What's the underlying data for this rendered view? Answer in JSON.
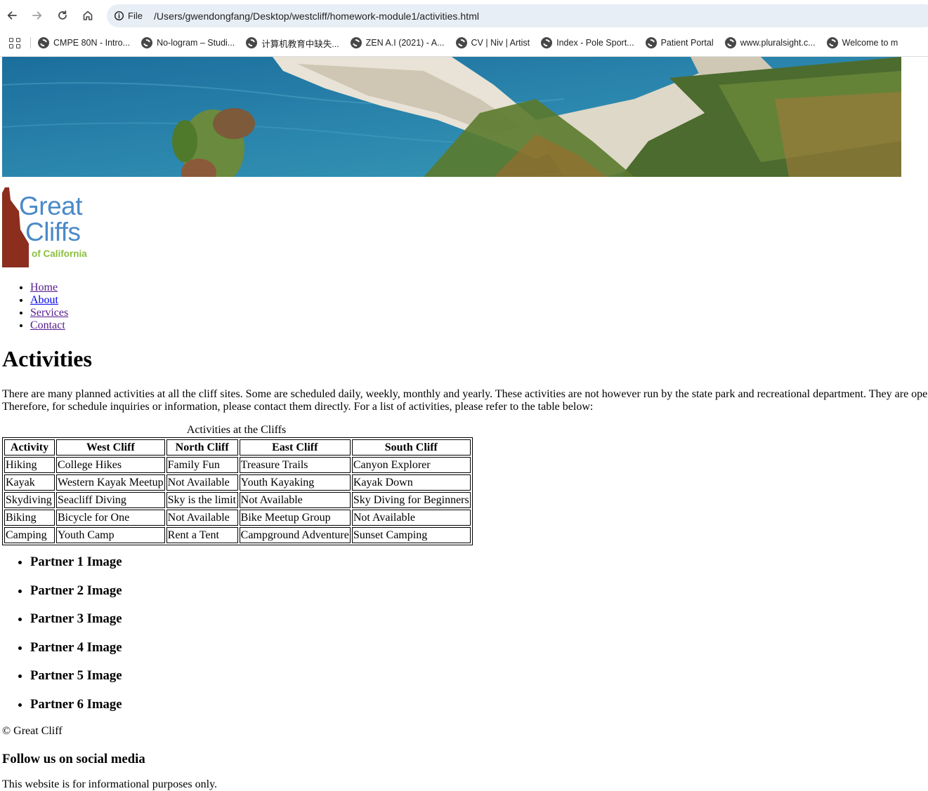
{
  "browser": {
    "address_chip": "File",
    "url": "/Users/gwendongfang/Desktop/westcliff/homework-module1/activities.html",
    "bookmarks": [
      "CMPE 80N - Intro...",
      "No-logram – Studi...",
      "计算机教育中缺失...",
      "ZEN A.I (2021) - A...",
      "CV | Niv | Artist",
      "Index - Pole Sport...",
      "Patient Portal",
      "www.pluralsight.c...",
      "Welcome to m"
    ]
  },
  "logo": {
    "line1": "Great",
    "line2": "Cliffs",
    "line3": "of California",
    "colors": {
      "text": "#4a8ac7",
      "accent": "#8cbf3f",
      "mark": "#8b2e1e"
    }
  },
  "nav": {
    "items": [
      "Home",
      "About",
      "Services",
      "Contact"
    ]
  },
  "page": {
    "title": "Activities",
    "intro_line1": "There are many planned activities at all the cliff sites. Some are scheduled daily, weekly, monthly and yearly. These activities are not however run by the state park and recreational department. They are ope",
    "intro_line2": "Therefore, for schedule inquiries or information, please contact them directly. For a list of activities, please refer to the table below:"
  },
  "table": {
    "caption": "Activities at the Cliffs",
    "headers": [
      "Activity",
      "West Cliff",
      "North Cliff",
      "East Cliff",
      "South Cliff"
    ],
    "rows": [
      [
        "Hiking",
        "College Hikes",
        "Family Fun",
        "Treasure Trails",
        "Canyon Explorer"
      ],
      [
        "Kayak",
        "Western Kayak Meetup",
        "Not Available",
        "Youth Kayaking",
        "Kayak Down"
      ],
      [
        "Skydiving",
        "Seacliff Diving",
        "Sky is the limit",
        "Not Available",
        "Sky Diving for Beginners"
      ],
      [
        "Biking",
        "Bicycle for One",
        "Not Available",
        "Bike Meetup Group",
        "Not Available"
      ],
      [
        "Camping",
        "Youth Camp",
        "Rent a Tent",
        "Campground Adventure",
        "Sunset Camping"
      ]
    ]
  },
  "partners": [
    "Partner 1 Image",
    "Partner 2 Image",
    "Partner 3 Image",
    "Partner 4 Image",
    "Partner 5 Image",
    "Partner 6 Image"
  ],
  "footer": {
    "copyright": "© Great Cliff",
    "social_heading": "Follow us on social media",
    "disclaimer": "This website is for informational purposes only."
  }
}
